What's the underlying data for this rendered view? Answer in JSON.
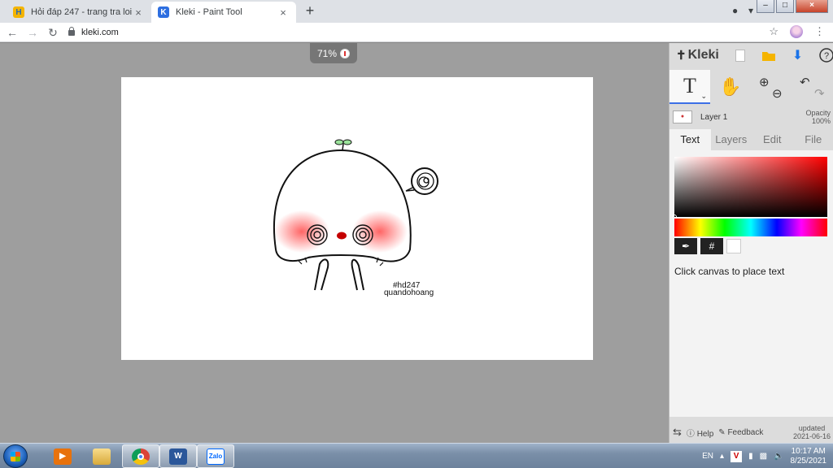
{
  "browser": {
    "tabs": [
      {
        "title": "Hỏi đáp 247 - trang tra loi",
        "favicon": "H",
        "active": false
      },
      {
        "title": "Kleki - Paint Tool",
        "favicon": "K",
        "active": true
      }
    ],
    "url": "kleki.com",
    "new_tab_label": "+",
    "tab_close_glyph": "×"
  },
  "canvas": {
    "zoom": "71%",
    "drawing_text_line1": "#hd247",
    "drawing_text_line2": "quandohoang"
  },
  "kleki": {
    "brand": "Kleki",
    "layer_name": "Layer 1",
    "opacity_label": "Opacity",
    "opacity_value": "100%",
    "tabs": [
      "Text",
      "Layers",
      "Edit",
      "File"
    ],
    "active_tab": "Text",
    "text_tool_glyph": "T",
    "hex_button": "#",
    "hint": "Click canvas to place text",
    "footer": {
      "help": "Help",
      "feedback": "Feedback",
      "updated_label": "updated",
      "updated_date": "2021-06-16"
    },
    "colors": {
      "accent": "#3c6fe6",
      "current_color": "#ffffff"
    }
  },
  "taskbar": {
    "language": "EN",
    "time": "10:17 AM",
    "date": "8/25/2021",
    "apps": [
      "media-player",
      "file-explorer",
      "chrome",
      "word",
      "zalo"
    ],
    "zalo_label": "Zalo",
    "word_label": "W"
  }
}
